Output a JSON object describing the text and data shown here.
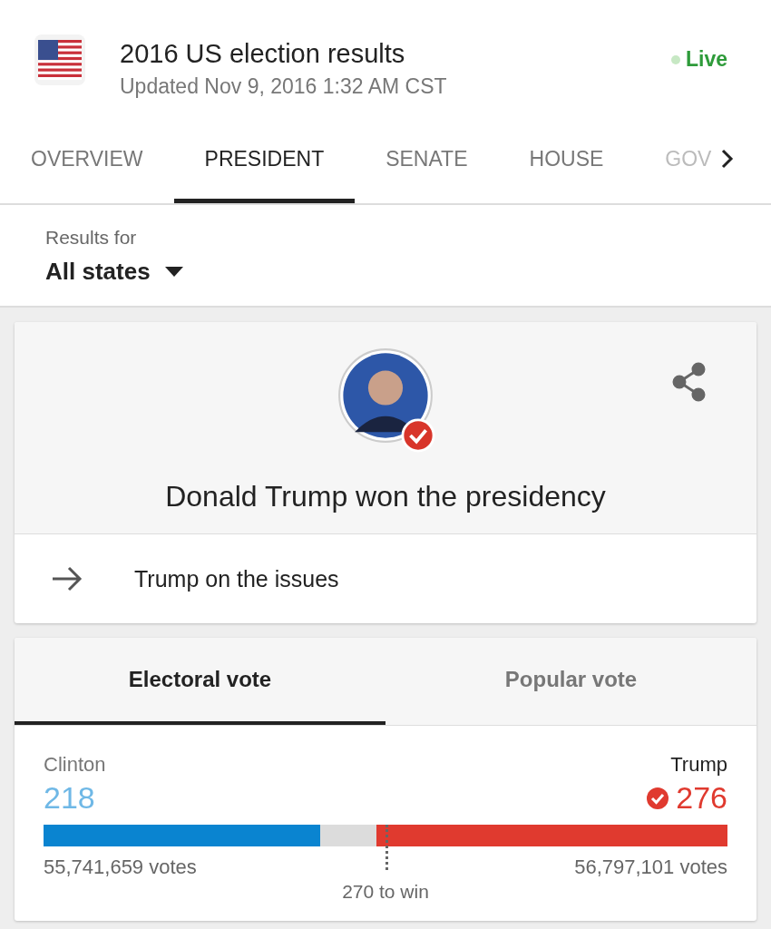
{
  "header": {
    "title": "2016 US election results",
    "updated": "Updated Nov 9, 2016 1:32 AM CST",
    "live": "Live"
  },
  "tabs": [
    {
      "label": "OVERVIEW",
      "selected": false
    },
    {
      "label": "PRESIDENT",
      "selected": true
    },
    {
      "label": "SENATE",
      "selected": false
    },
    {
      "label": "HOUSE",
      "selected": false
    },
    {
      "label": "GOV",
      "selected": false
    }
  ],
  "filter": {
    "label": "Results for",
    "value": "All states"
  },
  "winner_card": {
    "headline": "Donald Trump won the presidency",
    "link": "Trump on the issues"
  },
  "vote_tabs": [
    {
      "label": "Electoral vote",
      "selected": true
    },
    {
      "label": "Popular vote",
      "selected": false
    }
  ],
  "candidates": [
    {
      "name": "Clinton",
      "electoral": "218",
      "votes": "55,741,659 votes",
      "level": 0.405,
      "color": "#0a84d0",
      "winner": false
    },
    {
      "name": "Trump",
      "electoral": "276",
      "votes": "56,797,101 votes",
      "level": 0.513,
      "color": "#e03a2f",
      "winner": true
    }
  ],
  "threshold": {
    "label": "270 to win",
    "level": 0.5
  }
}
